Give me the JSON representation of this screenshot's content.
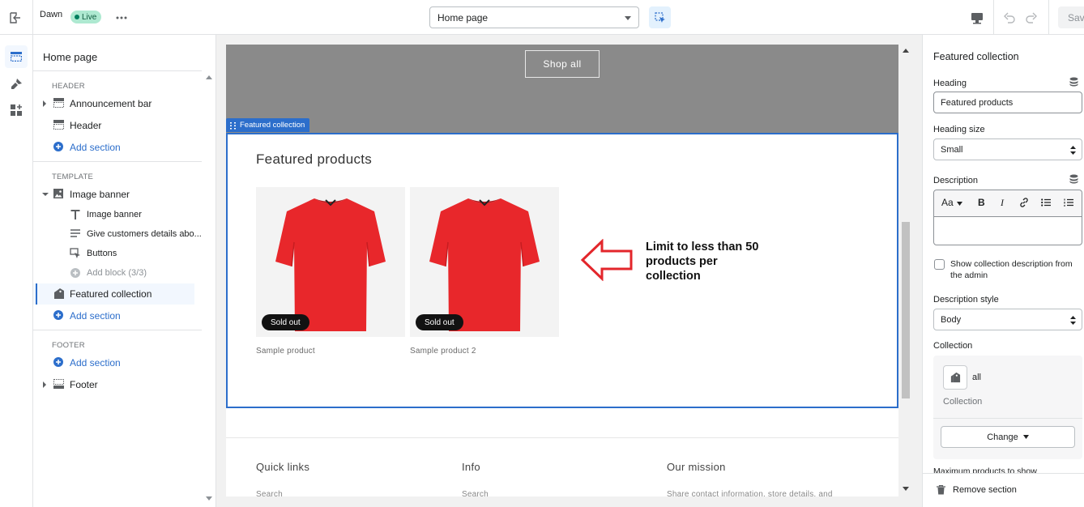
{
  "topbar": {
    "theme_name": "Dawn",
    "live_badge": "Live",
    "page_select": "Home page",
    "save_label": "Save"
  },
  "sidebar": {
    "title": "Home page",
    "header_group": "HEADER",
    "header_items": [
      "Announcement bar",
      "Header"
    ],
    "add_section": "Add section",
    "template_group": "TEMPLATE",
    "image_banner": "Image banner",
    "image_banner_blocks": [
      "Image banner",
      "Give customers details abo...",
      "Buttons"
    ],
    "add_block": "Add block (3/3)",
    "featured_collection": "Featured collection",
    "footer_group": "FOOTER",
    "footer_item": "Footer"
  },
  "preview": {
    "shop_all": "Shop all",
    "section_tag": "Featured collection",
    "heading": "Featured products",
    "products": [
      {
        "name": "Sample product",
        "badge": "Sold out"
      },
      {
        "name": "Sample product 2",
        "badge": "Sold out"
      }
    ],
    "annotation": "Limit to less than 50 products per collection",
    "footer": {
      "columns": [
        {
          "heading": "Quick links",
          "link": "Search"
        },
        {
          "heading": "Info",
          "link": "Search"
        },
        {
          "heading": "Our mission",
          "link": "Share contact information, store details, and"
        }
      ]
    }
  },
  "settings": {
    "title": "Featured collection",
    "heading_label": "Heading",
    "heading_value": "Featured products",
    "heading_size_label": "Heading size",
    "heading_size_value": "Small",
    "description_label": "Description",
    "rte_font": "Aa",
    "show_desc_label": "Show collection description from the admin",
    "description_style_label": "Description style",
    "description_style_value": "Body",
    "collection_label": "Collection",
    "collection_name": "all",
    "collection_type": "Collection",
    "change_label": "Change",
    "max_products_label": "Maximum products to show",
    "remove_label": "Remove section"
  },
  "colors": {
    "accent": "#2c6ecb",
    "product_red": "#e8272b",
    "annotation_arrow": "#e3262b"
  }
}
